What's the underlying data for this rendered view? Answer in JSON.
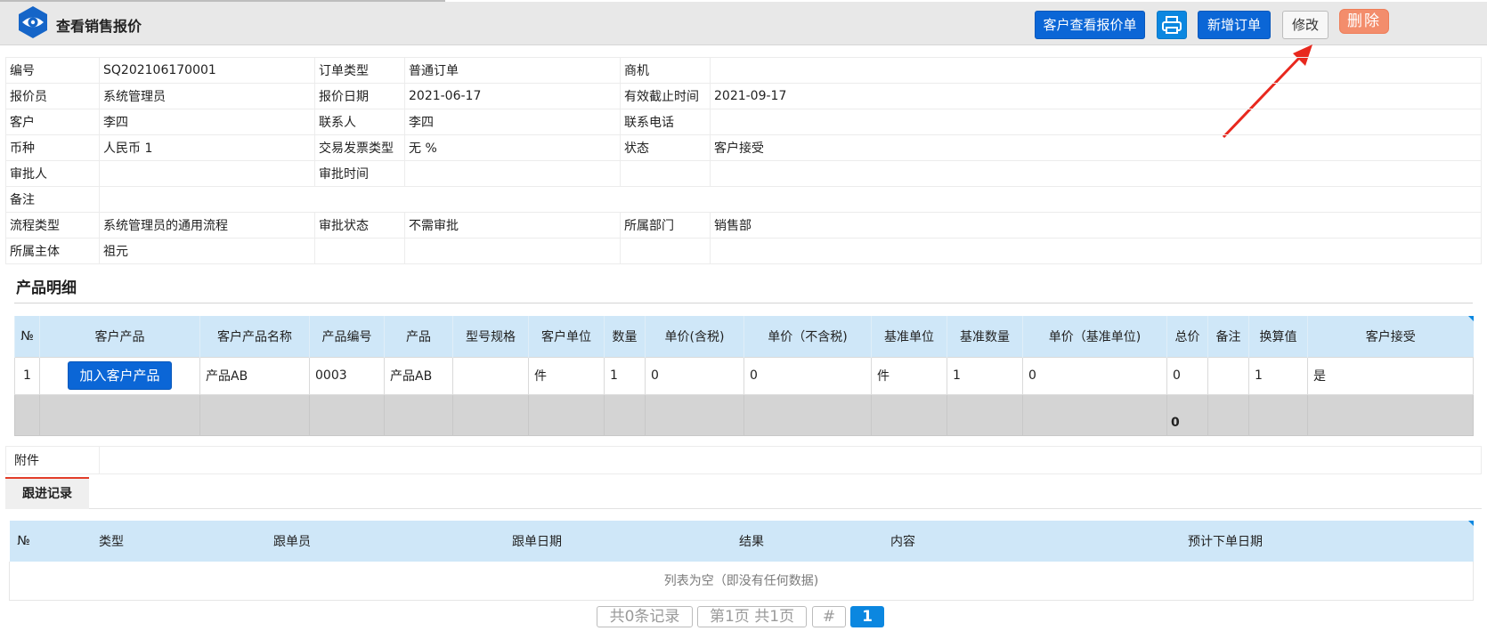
{
  "header": {
    "title": "查看销售报价",
    "buttons": {
      "customer_view": "客户查看报价单",
      "new_order": "新增订单",
      "edit": "修改",
      "delete": "删除"
    }
  },
  "info": {
    "rows": [
      [
        {
          "l": "编号",
          "v": "SQ202106170001"
        },
        {
          "l": "订单类型",
          "v": "普通订单"
        },
        {
          "l": "商机",
          "v": ""
        }
      ],
      [
        {
          "l": "报价员",
          "v": "系统管理员"
        },
        {
          "l": "报价日期",
          "v": "2021-06-17"
        },
        {
          "l": "有效截止时间",
          "v": "2021-09-17"
        }
      ],
      [
        {
          "l": "客户",
          "v": "李四"
        },
        {
          "l": "联系人",
          "v": "李四"
        },
        {
          "l": "联系电话",
          "v": ""
        }
      ],
      [
        {
          "l": "币种",
          "v": "人民币    1"
        },
        {
          "l": "交易发票类型",
          "v": "无    %"
        },
        {
          "l": "状态",
          "v": "客户接受"
        }
      ],
      [
        {
          "l": "审批人",
          "v": ""
        },
        {
          "l": "审批时间",
          "v": ""
        },
        {
          "l": "",
          "v": ""
        }
      ],
      [
        {
          "l": "备注",
          "v": ""
        }
      ],
      [
        {
          "l": "流程类型",
          "v": "系统管理员的通用流程"
        },
        {
          "l": "审批状态",
          "v": "不需审批"
        },
        {
          "l": "所属部门",
          "v": "销售部"
        }
      ],
      [
        {
          "l": "所属主体",
          "v": "祖元"
        },
        {
          "l": "",
          "v": ""
        },
        {
          "l": "",
          "v": ""
        }
      ]
    ]
  },
  "products": {
    "title": "产品明细",
    "columns": [
      "№",
      "客户产品",
      "客户产品名称",
      "产品编号",
      "产品",
      "型号规格",
      "客户单位",
      "数量",
      "单价(含税)",
      "单价（不含税)",
      "基准单位",
      "基准数量",
      "单价（基准单位)",
      "总价",
      "备注",
      "换算值",
      "客户接受"
    ],
    "rows": [
      [
        "1",
        "加入客户产品",
        "产品AB",
        "0003",
        "产品AB",
        "",
        "件",
        "1",
        "0",
        "0",
        "件",
        "1",
        "0",
        "0",
        "",
        "1",
        "是"
      ]
    ],
    "total": "0"
  },
  "attachment_label": "附件",
  "follow": {
    "tab": "跟进记录",
    "columns": [
      "№",
      "类型",
      "跟单员",
      "跟单日期",
      "结果",
      "内容",
      "预计下单日期"
    ],
    "empty": "列表为空（即没有任何数据)"
  },
  "pager": {
    "records": "共0条记录",
    "pages": "第1页 共1页",
    "jump": "#",
    "current": "1"
  },
  "colors": {
    "primary": "#0b66d6",
    "print": "#0b87e0",
    "delete": "#f38d6c",
    "table_header": "#cfe7f8",
    "tab_accent": "#e23d2a",
    "arrow": "#e8281e"
  },
  "icons": [
    "eye-logo-icon",
    "printer-icon",
    "annotation-arrow-icon"
  ]
}
